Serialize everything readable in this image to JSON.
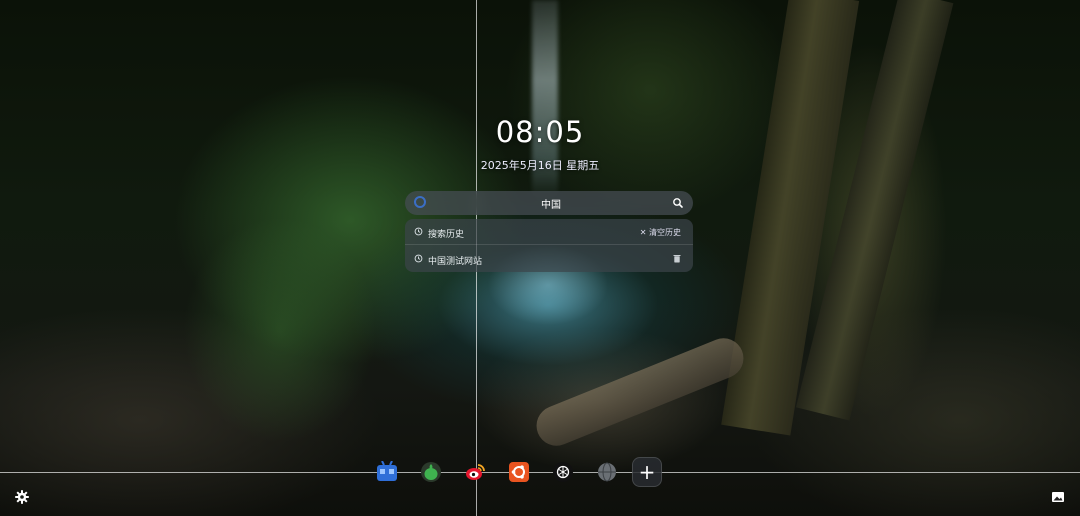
{
  "clock": {
    "time": "08:05",
    "date": "2025年5月16日 星期五"
  },
  "search": {
    "query": "中国",
    "engine_icon": "search-engine-icon",
    "submit_icon": "search-icon"
  },
  "suggestions": {
    "history_label": "搜索历史",
    "clear_label": "清空历史",
    "items": [
      {
        "label": "中国测试网站"
      }
    ]
  },
  "dock": {
    "apps": [
      {
        "name": "bilibili",
        "color": "#2f6fd8"
      },
      {
        "name": "green-app",
        "color": "#3fb34f"
      },
      {
        "name": "weibo",
        "color": "#e6162d"
      },
      {
        "name": "ubuntu",
        "color": "#e95420"
      },
      {
        "name": "chatgpt",
        "color": "#111111"
      },
      {
        "name": "globe",
        "color": "#6a6f74"
      }
    ],
    "add_label": "+"
  },
  "corner": {
    "settings_icon": "gear-icon",
    "wallpaper_icon": "image-icon"
  }
}
